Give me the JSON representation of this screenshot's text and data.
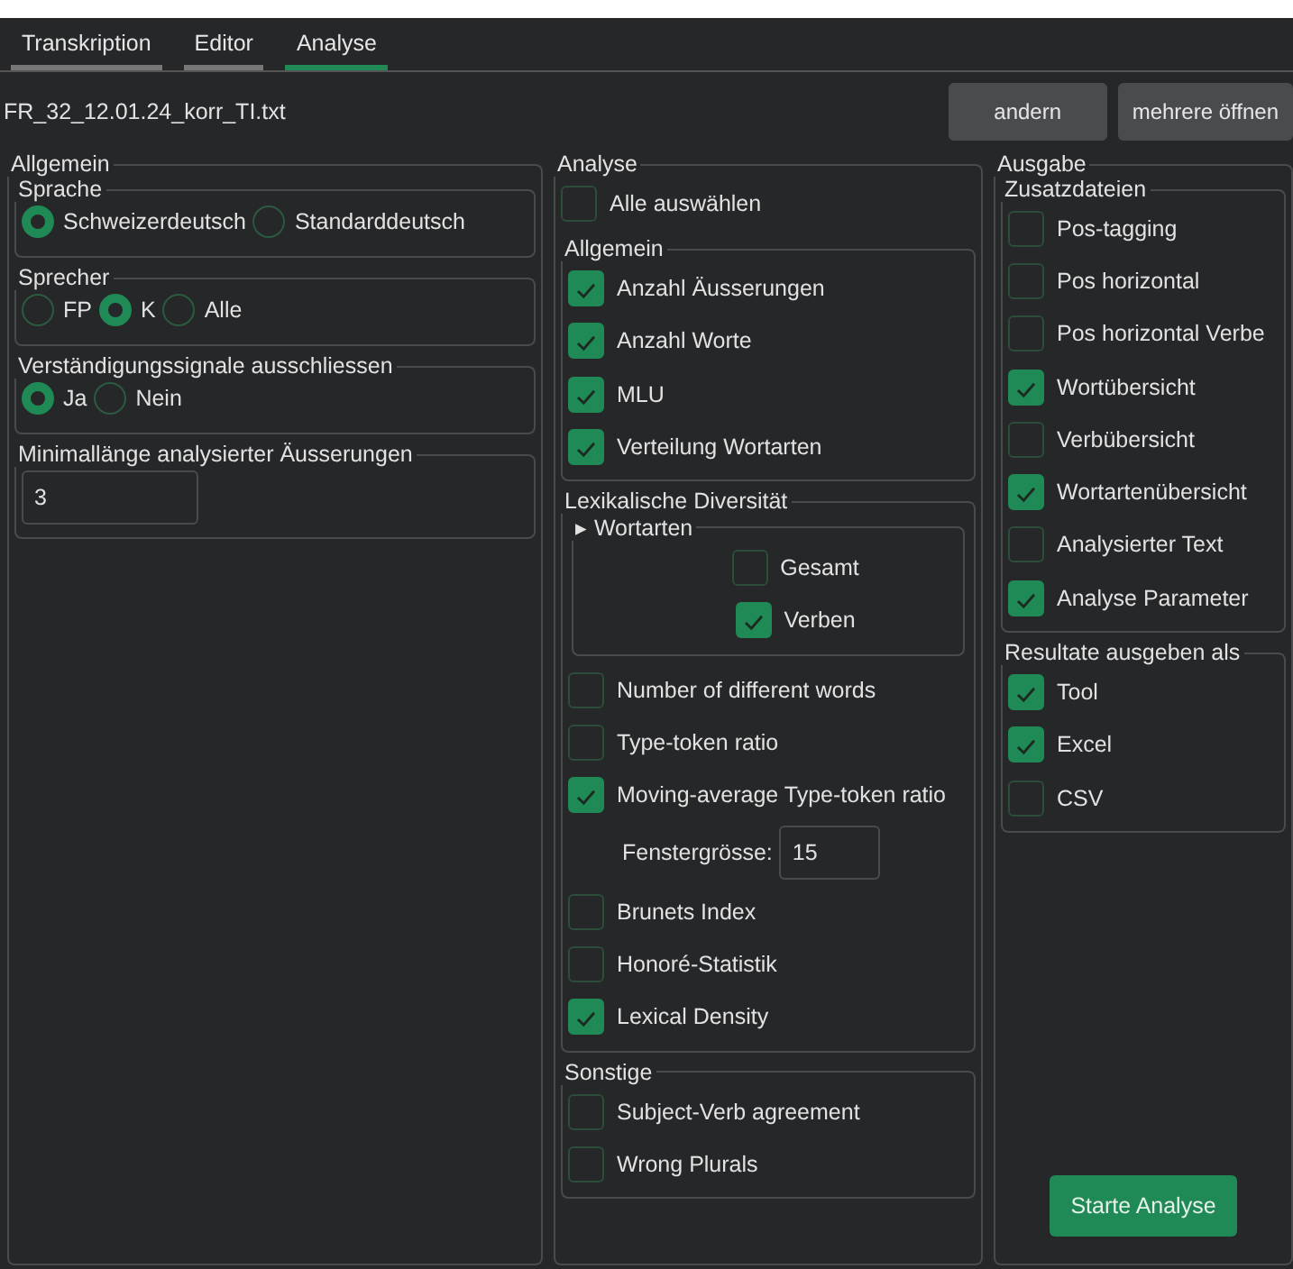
{
  "tabs": [
    {
      "label": "Transkription",
      "selected": false
    },
    {
      "label": "Editor",
      "selected": false
    },
    {
      "label": "Analyse",
      "selected": true
    }
  ],
  "file": {
    "name": "FR_32_12.01.24_korr_TI.txt"
  },
  "header_buttons": [
    "andern",
    "mehrere öffnen"
  ],
  "left": {
    "title": "Allgemein",
    "groups": [
      {
        "title": "Sprache",
        "kind": "radio",
        "options": [
          {
            "label": "Schweizerdeutsch",
            "selected": true
          },
          {
            "label": "Standarddeutsch",
            "selected": false
          }
        ]
      },
      {
        "title": "Sprecher",
        "kind": "radio",
        "options": [
          {
            "label": "FP",
            "selected": false
          },
          {
            "label": "K",
            "selected": true
          },
          {
            "label": "Alle",
            "selected": false
          }
        ]
      },
      {
        "title": "Verständigungssignale ausschliessen",
        "kind": "radio",
        "options": [
          {
            "label": "Ja",
            "selected": true
          },
          {
            "label": "Nein",
            "selected": false
          }
        ]
      },
      {
        "title": "Minimallänge analysierter Äusserungen",
        "kind": "input",
        "value": "3"
      }
    ]
  },
  "middle": {
    "title": "Analyse",
    "select_all": {
      "label": "Alle auswählen",
      "checked": false
    },
    "groups": [
      {
        "title": "Allgemein",
        "items": [
          {
            "kind": "checkbox",
            "label": "Anzahl Äusserungen",
            "checked": true
          },
          {
            "kind": "checkbox",
            "label": "Anzahl Worte",
            "checked": true
          },
          {
            "kind": "checkbox",
            "label": "MLU",
            "checked": true
          },
          {
            "kind": "checkbox",
            "label": "Verteilung Wortarten",
            "checked": true
          }
        ]
      },
      {
        "title": "Lexikalische Diversität",
        "subgroup": {
          "arrow": "▸",
          "title": "Wortarten",
          "items": [
            {
              "label": "Gesamt",
              "checked": false
            },
            {
              "label": "Verben",
              "checked": true
            }
          ]
        },
        "items": [
          {
            "kind": "checkbox",
            "label": "Number of different words",
            "checked": false
          },
          {
            "kind": "checkbox",
            "label": "Type-token ratio",
            "checked": false
          },
          {
            "kind": "checkbox",
            "label": "Moving-average Type-token ratio",
            "checked": true
          },
          {
            "kind": "number",
            "label": "Fenstergrösse:",
            "value": "15"
          },
          {
            "kind": "checkbox",
            "label": "Brunets Index",
            "checked": false
          },
          {
            "kind": "checkbox",
            "label": "Honoré-Statistik",
            "checked": false
          },
          {
            "kind": "checkbox",
            "label": "Lexical Density",
            "checked": true
          }
        ]
      },
      {
        "title": "Sonstige",
        "items": [
          {
            "kind": "checkbox",
            "label": "Subject-Verb agreement",
            "checked": false
          },
          {
            "kind": "checkbox",
            "label": "Wrong Plurals",
            "checked": false
          }
        ]
      }
    ]
  },
  "right": {
    "title": "Ausgabe",
    "groups": [
      {
        "title": "Zusatzdateien",
        "items": [
          {
            "label": "Pos-tagging",
            "checked": false
          },
          {
            "label": "Pos horizontal",
            "checked": false
          },
          {
            "label": "Pos horizontal Verbe",
            "checked": false
          },
          {
            "label": "Wortübersicht",
            "checked": true
          },
          {
            "label": "Verbübersicht",
            "checked": false
          },
          {
            "label": "Wortartenübersicht",
            "checked": true
          },
          {
            "label": "Analysierter Text",
            "checked": false
          },
          {
            "label": "Analyse Parameter",
            "checked": true
          }
        ]
      },
      {
        "title": "Resultate ausgeben als",
        "items": [
          {
            "label": "Tool",
            "checked": true
          },
          {
            "label": "Excel",
            "checked": true
          },
          {
            "label": "CSV",
            "checked": false
          }
        ]
      }
    ],
    "button": "Starte Analyse"
  }
}
